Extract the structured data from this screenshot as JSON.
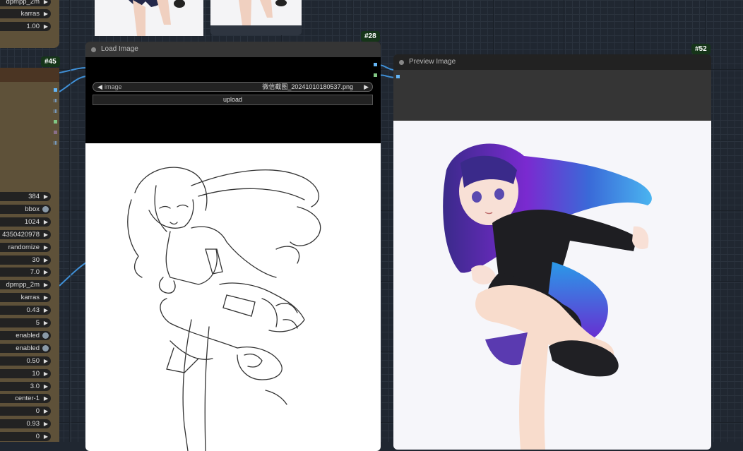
{
  "node_badges": {
    "n45": "#45",
    "n28": "#28",
    "n52": "#52"
  },
  "top_left_widgets": [
    "dpmpp_2m",
    "karras",
    "1.00"
  ],
  "sampler_widgets": [
    {
      "value": "384",
      "kind": "number"
    },
    {
      "value": "bbox",
      "kind": "toggle"
    },
    {
      "value": "1024",
      "kind": "number"
    },
    {
      "value": "4350420978",
      "kind": "number"
    },
    {
      "value": "randomize",
      "kind": "number"
    },
    {
      "value": "30",
      "kind": "number"
    },
    {
      "value": "7.0",
      "kind": "number"
    },
    {
      "value": "dpmpp_2m",
      "kind": "number"
    },
    {
      "value": "karras",
      "kind": "number"
    },
    {
      "value": "0.43",
      "kind": "number"
    },
    {
      "value": "5",
      "kind": "number"
    },
    {
      "value": "enabled",
      "kind": "toggle"
    },
    {
      "value": "enabled",
      "kind": "toggle"
    },
    {
      "value": "0.50",
      "kind": "number"
    },
    {
      "value": "10",
      "kind": "number"
    },
    {
      "value": "3.0",
      "kind": "number"
    },
    {
      "value": "center-1",
      "kind": "number"
    },
    {
      "value": "0",
      "kind": "number"
    },
    {
      "value": "0.93",
      "kind": "number"
    },
    {
      "value": "0",
      "kind": "number"
    }
  ],
  "load_image": {
    "title": "Load Image",
    "image_label": "image",
    "image_value": "微信截图_20241010180537.png",
    "upload_label": "upload"
  },
  "preview_image": {
    "title": "Preview Image"
  },
  "icons": {
    "left_arrow": "◀",
    "right_arrow": "▶"
  },
  "colors": {
    "link_blue": "#3f8fd6",
    "image_socket": "#64b5f6",
    "mask_socket": "#81c784"
  }
}
